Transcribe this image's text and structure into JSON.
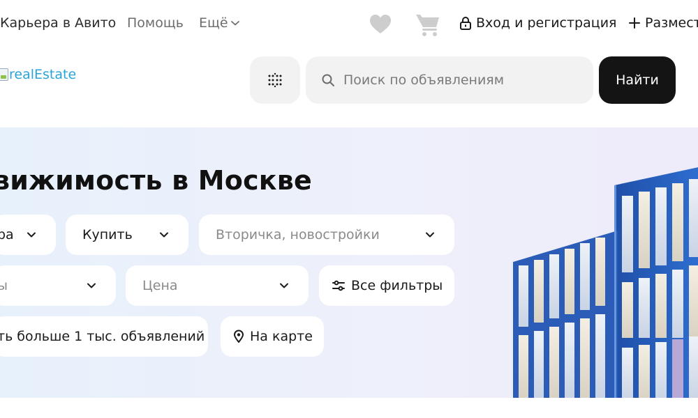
{
  "topnav": {
    "career": "Карьера в Авито",
    "help": "Помощь",
    "more": "Ещё",
    "login": "Вход и регистрация",
    "post": "Размест"
  },
  "header": {
    "logo_text": "realEstate",
    "search_placeholder": "Поиск по объявлениям",
    "search_value": "",
    "find_button": "Найти"
  },
  "hero": {
    "title": "вижимость в Москве",
    "filters": {
      "type": "ра",
      "deal": "Купить",
      "market_placeholder": "Вторичка, новостройки",
      "rooms_placeholder": "ы",
      "price_placeholder": "Цена",
      "all_filters": "Все фильтры",
      "show_results": "ть больше 1 тыс. объявлений",
      "on_map": "На карте"
    }
  },
  "icons": {
    "more": "chevron-down-icon",
    "favorites": "heart-icon",
    "cart": "cart-icon",
    "login": "lock-icon",
    "post": "plus-icon",
    "catalog": "dots-grid-icon",
    "search": "search-icon",
    "filters": "sliders-icon",
    "map": "map-pin-icon"
  },
  "colors": {
    "accent_dark": "#141414",
    "logo_text": "#2aa4d8",
    "field_bg": "#f2f2f2",
    "hero_bg_start": "#e7f1fb",
    "hero_bg_end": "#eeebfa",
    "muted_text": "#8a8a8a"
  }
}
